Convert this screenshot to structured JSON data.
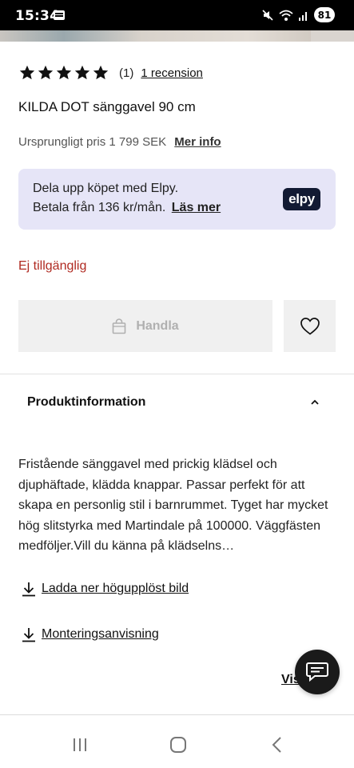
{
  "status_bar": {
    "time": "15:34",
    "battery": "81",
    "icons": [
      "notification-icon",
      "mute-icon",
      "wifi-icon",
      "signal-icon",
      "battery-icon"
    ]
  },
  "product": {
    "rating_count": "(1)",
    "review_link": "1 recension",
    "title": "KILDA DOT sänggavel 90 cm",
    "price_text": "Ursprungligt pris 1 799 SEK",
    "more_info": "Mer info",
    "availability": "Ej tillgänglig",
    "stars": 5
  },
  "elpy": {
    "line1": "Dela upp köpet med Elpy.",
    "line2": "Betala från 136 kr/mån.",
    "link": "Läs mer",
    "logo": "elpy"
  },
  "actions": {
    "buy_label": "Handla"
  },
  "product_info": {
    "title": "Produktinformation",
    "description": "Fristående sänggavel med prickig klädsel och djuphäftade, klädda knappar. Passar perfekt för att skapa en personlig stil i barnrummet. Tyget har mycket hög slitstyrka med Martindale på 100000. Väggfästen medföljer.Vill du känna på klädselns…",
    "download_hires": "Ladda ner högupplöst bild",
    "download_mounting": "Monteringsanvisning",
    "show_more": "Visa"
  },
  "colors": {
    "availability": "#b02a21",
    "elpy_bg": "#e6e5f7",
    "elpy_logo_bg": "#121a33",
    "button_bg": "#f0f0f0"
  }
}
